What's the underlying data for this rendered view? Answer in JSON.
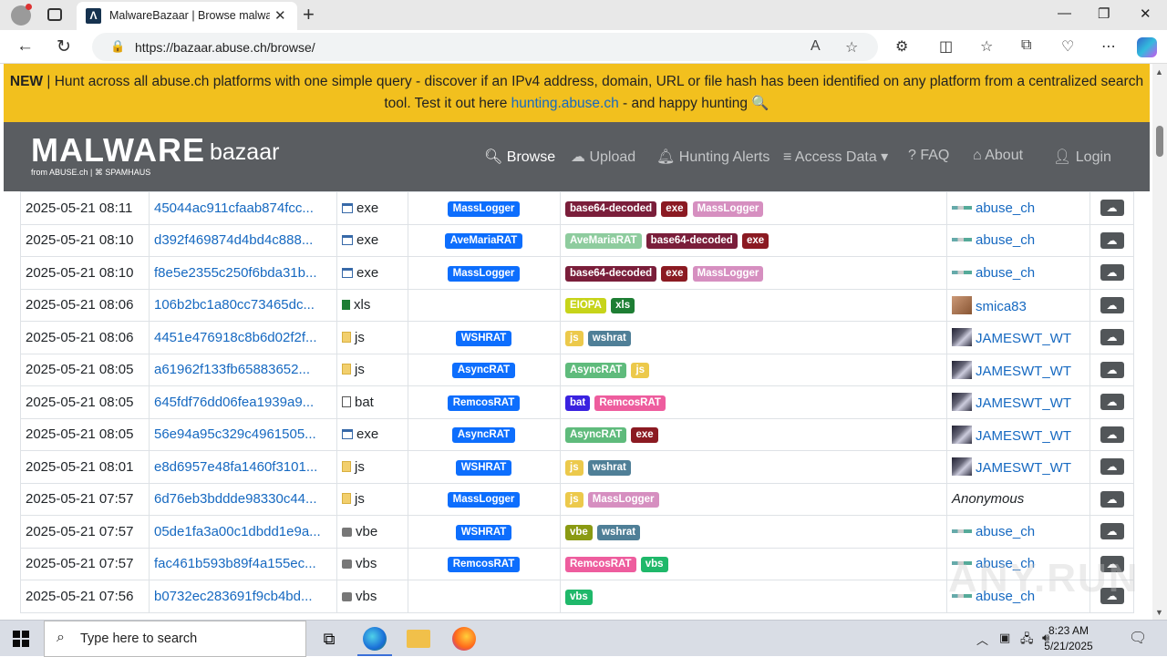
{
  "browser": {
    "tab_title": "MalwareBazaar | Browse malware",
    "url": "https://bazaar.abuse.ch/browse/"
  },
  "banner": {
    "new_label": "NEW",
    "text_before": " | Hunt across all abuse.ch platforms with one simple query - discover if an IPv4 address, domain, URL or file hash has been identified on any platform from a centralized search tool. Test it out here ",
    "link_text": "hunting.abuse.ch",
    "text_after": " - and happy hunting 🔍"
  },
  "logo": {
    "main": "MALWARE",
    "sub": "bazaar",
    "from": "from ABUSE.ch | ⌘ SPAMHAUS"
  },
  "nav": {
    "browse": "Browse",
    "upload": "Upload",
    "hunting_alerts": "Hunting Alerts",
    "access_data": "Access Data",
    "faq": "FAQ",
    "about": "About",
    "login": "Login"
  },
  "colors": {
    "banner": "#f2c01e",
    "navbar": "#5a5d61",
    "link": "#1669c1",
    "signature_badge": "#0d6efd"
  },
  "tag_colors": {
    "base64-decoded": "#7a1e3a",
    "exe": "#8b1a22",
    "MassLogger": "#d68fc0",
    "AveMariaRAT": "#8ecc9e",
    "EIOPA": "#c7d41a",
    "xls": "#1e7e34",
    "js": "#ecc94b",
    "wshrat": "#4f7f97",
    "AsyncRAT": "#5fbb7c",
    "bat": "#3a22e0",
    "RemcosRAT": "#ee5d9e",
    "vbe": "#8a9a12",
    "vbs": "#1fb86a"
  },
  "rows": [
    {
      "date": "2025-05-21 08:11",
      "hash": "45044ac911cfaab874fcc...",
      "ftype": "exe",
      "ficon": "exe",
      "signature": "MassLogger",
      "tags": [
        "base64-decoded",
        "exe",
        "MassLogger"
      ],
      "reporter": "abuse_ch",
      "avatar": "abuse"
    },
    {
      "date": "2025-05-21 08:10",
      "hash": "d392f469874d4bd4c888...",
      "ftype": "exe",
      "ficon": "exe",
      "signature": "AveMariaRAT",
      "tags": [
        "AveMariaRAT",
        "base64-decoded",
        "exe"
      ],
      "reporter": "abuse_ch",
      "avatar": "abuse"
    },
    {
      "date": "2025-05-21 08:10",
      "hash": "f8e5e2355c250f6bda31b...",
      "ftype": "exe",
      "ficon": "exe",
      "signature": "MassLogger",
      "tags": [
        "base64-decoded",
        "exe",
        "MassLogger"
      ],
      "reporter": "abuse_ch",
      "avatar": "abuse"
    },
    {
      "date": "2025-05-21 08:06",
      "hash": "106b2bc1a80cc73465dc...",
      "ftype": "xls",
      "ficon": "xls",
      "signature": "",
      "tags": [
        "EIOPA",
        "xls"
      ],
      "reporter": "smica83",
      "avatar": "smica"
    },
    {
      "date": "2025-05-21 08:06",
      "hash": "4451e476918c8b6d02f2f...",
      "ftype": "js",
      "ficon": "js",
      "signature": "WSHRAT",
      "tags": [
        "js",
        "wshrat"
      ],
      "reporter": "JAMESWT_WT",
      "avatar": "james"
    },
    {
      "date": "2025-05-21 08:05",
      "hash": "a61962f133fb65883652...",
      "ftype": "js",
      "ficon": "js",
      "signature": "AsyncRAT",
      "tags": [
        "AsyncRAT",
        "js"
      ],
      "reporter": "JAMESWT_WT",
      "avatar": "james"
    },
    {
      "date": "2025-05-21 08:05",
      "hash": "645fdf76dd06fea1939a9...",
      "ftype": "bat",
      "ficon": "bat",
      "signature": "RemcosRAT",
      "tags": [
        "bat",
        "RemcosRAT"
      ],
      "reporter": "JAMESWT_WT",
      "avatar": "james"
    },
    {
      "date": "2025-05-21 08:05",
      "hash": "56e94a95c329c4961505...",
      "ftype": "exe",
      "ficon": "exe",
      "signature": "AsyncRAT",
      "tags": [
        "AsyncRAT",
        "exe"
      ],
      "reporter": "JAMESWT_WT",
      "avatar": "james"
    },
    {
      "date": "2025-05-21 08:01",
      "hash": "e8d6957e48fa1460f3101...",
      "ftype": "js",
      "ficon": "js",
      "signature": "WSHRAT",
      "tags": [
        "js",
        "wshrat"
      ],
      "reporter": "JAMESWT_WT",
      "avatar": "james"
    },
    {
      "date": "2025-05-21 07:57",
      "hash": "6d76eb3bddde98330c44...",
      "ftype": "js",
      "ficon": "js",
      "signature": "MassLogger",
      "tags": [
        "js",
        "MassLogger"
      ],
      "reporter": "Anonymous",
      "avatar": "none"
    },
    {
      "date": "2025-05-21 07:57",
      "hash": "05de1fa3a00c1dbdd1e9a...",
      "ftype": "vbe",
      "ficon": "vb",
      "signature": "WSHRAT",
      "tags": [
        "vbe",
        "wshrat"
      ],
      "reporter": "abuse_ch",
      "avatar": "abuse"
    },
    {
      "date": "2025-05-21 07:57",
      "hash": "fac461b593b89f4a155ec...",
      "ftype": "vbs",
      "ficon": "vb",
      "signature": "RemcosRAT",
      "tags": [
        "RemcosRAT",
        "vbs"
      ],
      "reporter": "abuse_ch",
      "avatar": "abuse"
    },
    {
      "date": "2025-05-21 07:56",
      "hash": "b0732ec283691f9cb4bd...",
      "ftype": "vbs",
      "ficon": "vb",
      "signature": "",
      "tags": [
        "vbs"
      ],
      "reporter": "abuse_ch",
      "avatar": "abuse"
    }
  ],
  "taskbar": {
    "search_placeholder": "Type here to search",
    "time": "8:23 AM",
    "date": "5/21/2025"
  },
  "watermark": "ANY.RUN"
}
